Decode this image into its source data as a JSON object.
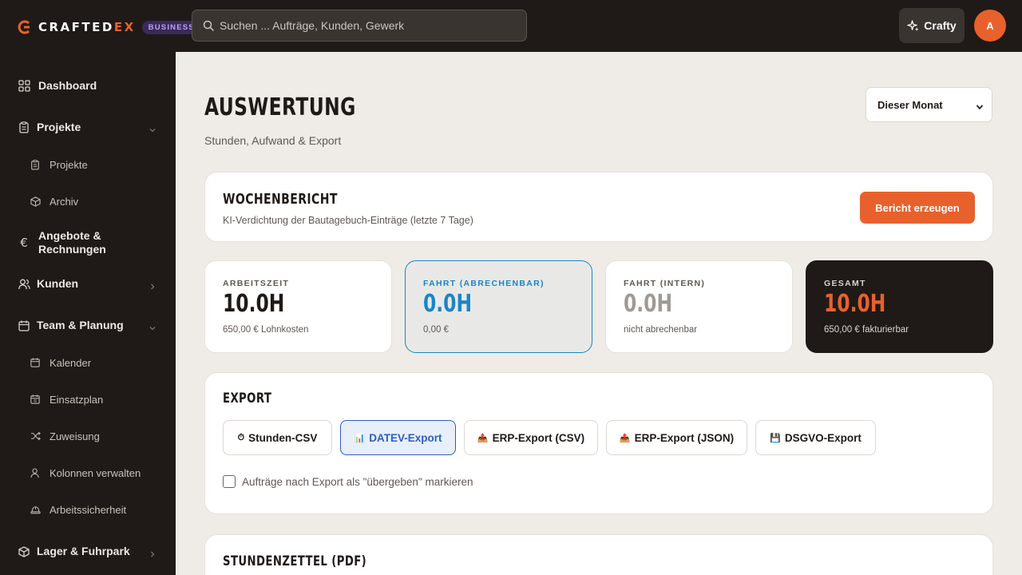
{
  "brand": {
    "name_main": "CRAFTED",
    "name_accent": "EX",
    "badge": "BUSINESS",
    "accent_color": "#e8612c"
  },
  "header": {
    "search_placeholder": "Suchen ... Aufträge, Kunden, Gewerk",
    "assistant_label": "Crafty",
    "avatar_initial": "A"
  },
  "sidebar": {
    "items": [
      {
        "label": "Dashboard",
        "icon": "grid-icon",
        "level": 0
      },
      {
        "label": "Projekte",
        "icon": "clipboard-icon",
        "level": 0,
        "chevron": "down"
      },
      {
        "label": "Projekte",
        "icon": "clipboard-icon",
        "level": 1
      },
      {
        "label": "Archiv",
        "icon": "box-icon",
        "level": 1
      },
      {
        "label": "Angebote & Rechnungen",
        "icon": "euro-icon",
        "level": 0
      },
      {
        "label": "Kunden",
        "icon": "users-icon",
        "level": 0,
        "chevron": "right"
      },
      {
        "label": "Team & Planung",
        "icon": "calendar-icon",
        "level": 0,
        "chevron": "down"
      },
      {
        "label": "Kalender",
        "icon": "calendar-icon",
        "level": 1
      },
      {
        "label": "Einsatzplan",
        "icon": "calendar-grid-icon",
        "level": 1
      },
      {
        "label": "Zuweisung",
        "icon": "shuffle-icon",
        "level": 1
      },
      {
        "label": "Kolonnen verwalten",
        "icon": "user-icon",
        "level": 1
      },
      {
        "label": "Arbeitssicherheit",
        "icon": "helmet-icon",
        "level": 1
      },
      {
        "label": "Lager & Fuhrpark",
        "icon": "package-icon",
        "level": 0,
        "chevron": "right"
      }
    ]
  },
  "main": {
    "title": "AUSWERTUNG",
    "subtitle": "Stunden, Aufwand & Export",
    "period_select": {
      "selected": "Dieser Monat"
    },
    "weekly_report": {
      "title": "WOCHENBERICHT",
      "description": "KI-Verdichtung der Bautagebuch-Einträge (letzte 7 Tage)",
      "button": "Bericht erzeugen"
    },
    "stats": [
      {
        "label": "ARBEITSZEIT",
        "value": "10.0H",
        "sub": "650,00 € Lohnkosten",
        "style": "default"
      },
      {
        "label": "FAHRT (ABRECHENBAR)",
        "value": "0.0H",
        "sub": "0,00 €",
        "style": "blue"
      },
      {
        "label": "FAHRT (INTERN)",
        "value": "0.0H",
        "sub": "nicht abrechenbar",
        "style": "grey"
      },
      {
        "label": "GESAMT",
        "value": "10.0H",
        "sub": "650,00 € fakturierbar",
        "style": "dark"
      }
    ],
    "export": {
      "title": "EXPORT",
      "buttons": [
        {
          "label": "Stunden-CSV",
          "icon": "⏱"
        },
        {
          "label": "DATEV-Export",
          "icon": "📊",
          "active": true
        },
        {
          "label": "ERP-Export (CSV)",
          "icon": "📤"
        },
        {
          "label": "ERP-Export (JSON)",
          "icon": "📤"
        },
        {
          "label": "DSGVO-Export",
          "icon": "💾"
        }
      ],
      "checkbox_label": "Aufträge nach Export als \"übergeben\" markieren"
    },
    "timesheet": {
      "title": "STUNDENZETTEL (PDF)"
    }
  }
}
